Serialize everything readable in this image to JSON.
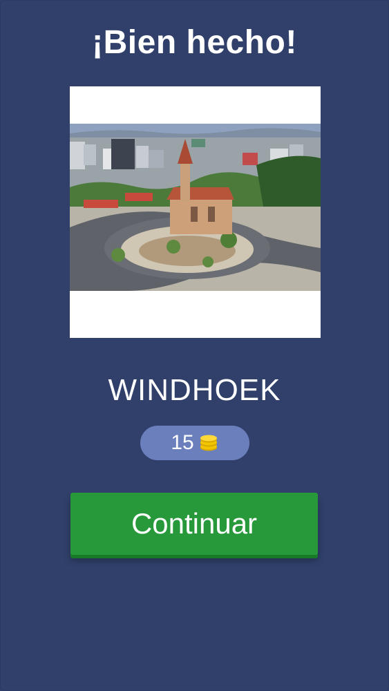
{
  "header": {
    "title": "¡Bien hecho!"
  },
  "image": {
    "icon": "city-photo-windhoek"
  },
  "answer": {
    "text": "WINDHOEK"
  },
  "coins": {
    "value": "15",
    "icon": "coin-stack-icon",
    "color": "#f2c500"
  },
  "actions": {
    "continue_label": "Continuar"
  },
  "colors": {
    "background": "#30406a",
    "pill": "#6b7fbd",
    "button": "#27993a"
  }
}
